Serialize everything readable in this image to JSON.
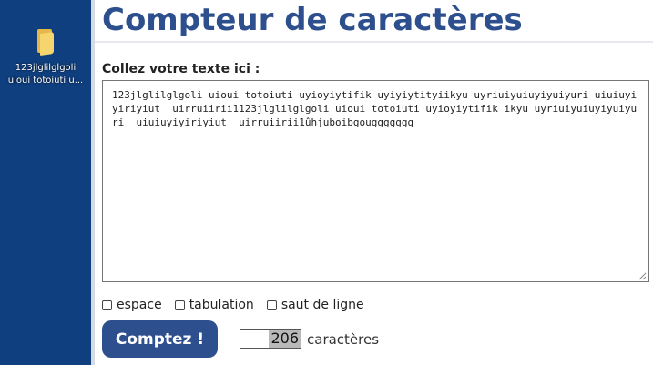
{
  "desktop": {
    "icon": "folder-icon",
    "label": "123jlglilglgoli uioui totoiuti u..."
  },
  "page": {
    "title": "Compteur de caractères",
    "text_label": "Collez votre texte ici :",
    "text_value": "123jlglilglgoli uioui totoiuti uyioyiytifik uyiyiytityiikyu uyriuiyuiuyiyuiyuri uiuiuyiyiriyiut  uirruiirii1123jlglilglgoli uioui totoiuti uyioyiytifik ikyu uyriuiyuiuyiyuiyuri  uiuiuyiyiriyiut  uirruiirii1ûhjuboibgouggggggg",
    "options": [
      {
        "label": "espace"
      },
      {
        "label": "tabulation"
      },
      {
        "label": "saut de ligne"
      }
    ],
    "count_button": "Comptez !",
    "result_value": "206",
    "result_unit": "caractères"
  },
  "colors": {
    "accent": "#2d4f8e",
    "desktop": "#0f3f7f"
  }
}
